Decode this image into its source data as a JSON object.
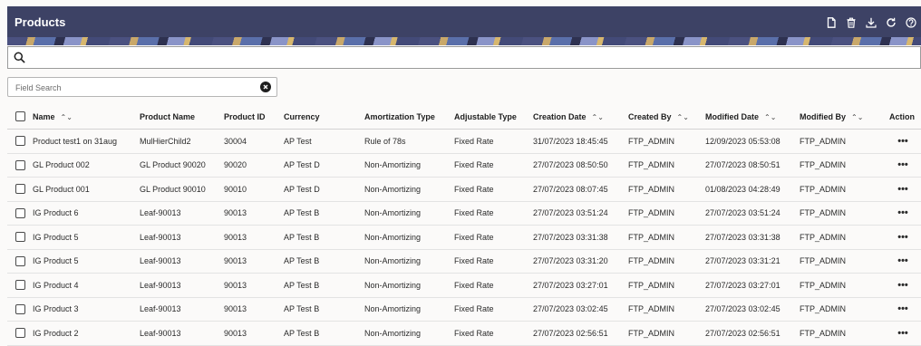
{
  "header": {
    "title": "Products",
    "actions": [
      {
        "name": "add-icon"
      },
      {
        "name": "delete-icon"
      },
      {
        "name": "download-icon"
      },
      {
        "name": "refresh-icon"
      },
      {
        "name": "help-icon"
      }
    ]
  },
  "search": {
    "value": "",
    "placeholder": ""
  },
  "field_search": {
    "placeholder": "Field Search"
  },
  "table": {
    "columns": {
      "name": "Name",
      "product_name": "Product Name",
      "product_id": "Product ID",
      "currency": "Currency",
      "amortization_type": "Amortization Type",
      "adjustable_type": "Adjustable Type",
      "creation_date": "Creation Date",
      "created_by": "Created By",
      "modified_date": "Modified Date",
      "modified_by": "Modified By",
      "action": "Action"
    },
    "sort_indicator": "⌃⌄",
    "action_label": "•••",
    "rows": [
      {
        "name": "Product test1 on 31aug",
        "product_name": "MulHierChild2",
        "product_id": "30004",
        "currency": "AP Test",
        "amortization_type": "Rule of 78s",
        "adjustable_type": "Fixed Rate",
        "creation_date": "31/07/2023 18:45:45",
        "created_by": "FTP_ADMIN",
        "modified_date": "12/09/2023 05:53:08",
        "modified_by": "FTP_ADMIN"
      },
      {
        "name": "GL Product 002",
        "product_name": "GL Product 90020",
        "product_id": "90020",
        "currency": "AP Test D",
        "amortization_type": "Non-Amortizing",
        "adjustable_type": "Fixed Rate",
        "creation_date": "27/07/2023 08:50:50",
        "created_by": "FTP_ADMIN",
        "modified_date": "27/07/2023 08:50:51",
        "modified_by": "FTP_ADMIN"
      },
      {
        "name": "GL Product 001",
        "product_name": "GL Product 90010",
        "product_id": "90010",
        "currency": "AP Test D",
        "amortization_type": "Non-Amortizing",
        "adjustable_type": "Fixed Rate",
        "creation_date": "27/07/2023 08:07:45",
        "created_by": "FTP_ADMIN",
        "modified_date": "01/08/2023 04:28:49",
        "modified_by": "FTP_ADMIN"
      },
      {
        "name": "IG Product 6",
        "product_name": "Leaf-90013",
        "product_id": "90013",
        "currency": "AP Test B",
        "amortization_type": "Non-Amortizing",
        "adjustable_type": "Fixed Rate",
        "creation_date": "27/07/2023 03:51:24",
        "created_by": "FTP_ADMIN",
        "modified_date": "27/07/2023 03:51:24",
        "modified_by": "FTP_ADMIN"
      },
      {
        "name": "IG Product 5",
        "product_name": "Leaf-90013",
        "product_id": "90013",
        "currency": "AP Test B",
        "amortization_type": "Non-Amortizing",
        "adjustable_type": "Fixed Rate",
        "creation_date": "27/07/2023 03:31:38",
        "created_by": "FTP_ADMIN",
        "modified_date": "27/07/2023 03:31:38",
        "modified_by": "FTP_ADMIN"
      },
      {
        "name": "IG Product 5",
        "product_name": "Leaf-90013",
        "product_id": "90013",
        "currency": "AP Test B",
        "amortization_type": "Non-Amortizing",
        "adjustable_type": "Fixed Rate",
        "creation_date": "27/07/2023 03:31:20",
        "created_by": "FTP_ADMIN",
        "modified_date": "27/07/2023 03:31:21",
        "modified_by": "FTP_ADMIN"
      },
      {
        "name": "IG Product 4",
        "product_name": "Leaf-90013",
        "product_id": "90013",
        "currency": "AP Test B",
        "amortization_type": "Non-Amortizing",
        "adjustable_type": "Fixed Rate",
        "creation_date": "27/07/2023 03:27:01",
        "created_by": "FTP_ADMIN",
        "modified_date": "27/07/2023 03:27:01",
        "modified_by": "FTP_ADMIN"
      },
      {
        "name": "IG Product 3",
        "product_name": "Leaf-90013",
        "product_id": "90013",
        "currency": "AP Test B",
        "amortization_type": "Non-Amortizing",
        "adjustable_type": "Fixed Rate",
        "creation_date": "27/07/2023 03:02:45",
        "created_by": "FTP_ADMIN",
        "modified_date": "27/07/2023 03:02:45",
        "modified_by": "FTP_ADMIN"
      },
      {
        "name": "IG Product 2",
        "product_name": "Leaf-90013",
        "product_id": "90013",
        "currency": "AP Test B",
        "amortization_type": "Non-Amortizing",
        "adjustable_type": "Fixed Rate",
        "creation_date": "27/07/2023 02:56:51",
        "created_by": "FTP_ADMIN",
        "modified_date": "27/07/2023 02:56:51",
        "modified_by": "FTP_ADMIN"
      }
    ]
  },
  "colors": {
    "header_bg": "#3d4265",
    "page_bg": "#fbfaf9"
  }
}
